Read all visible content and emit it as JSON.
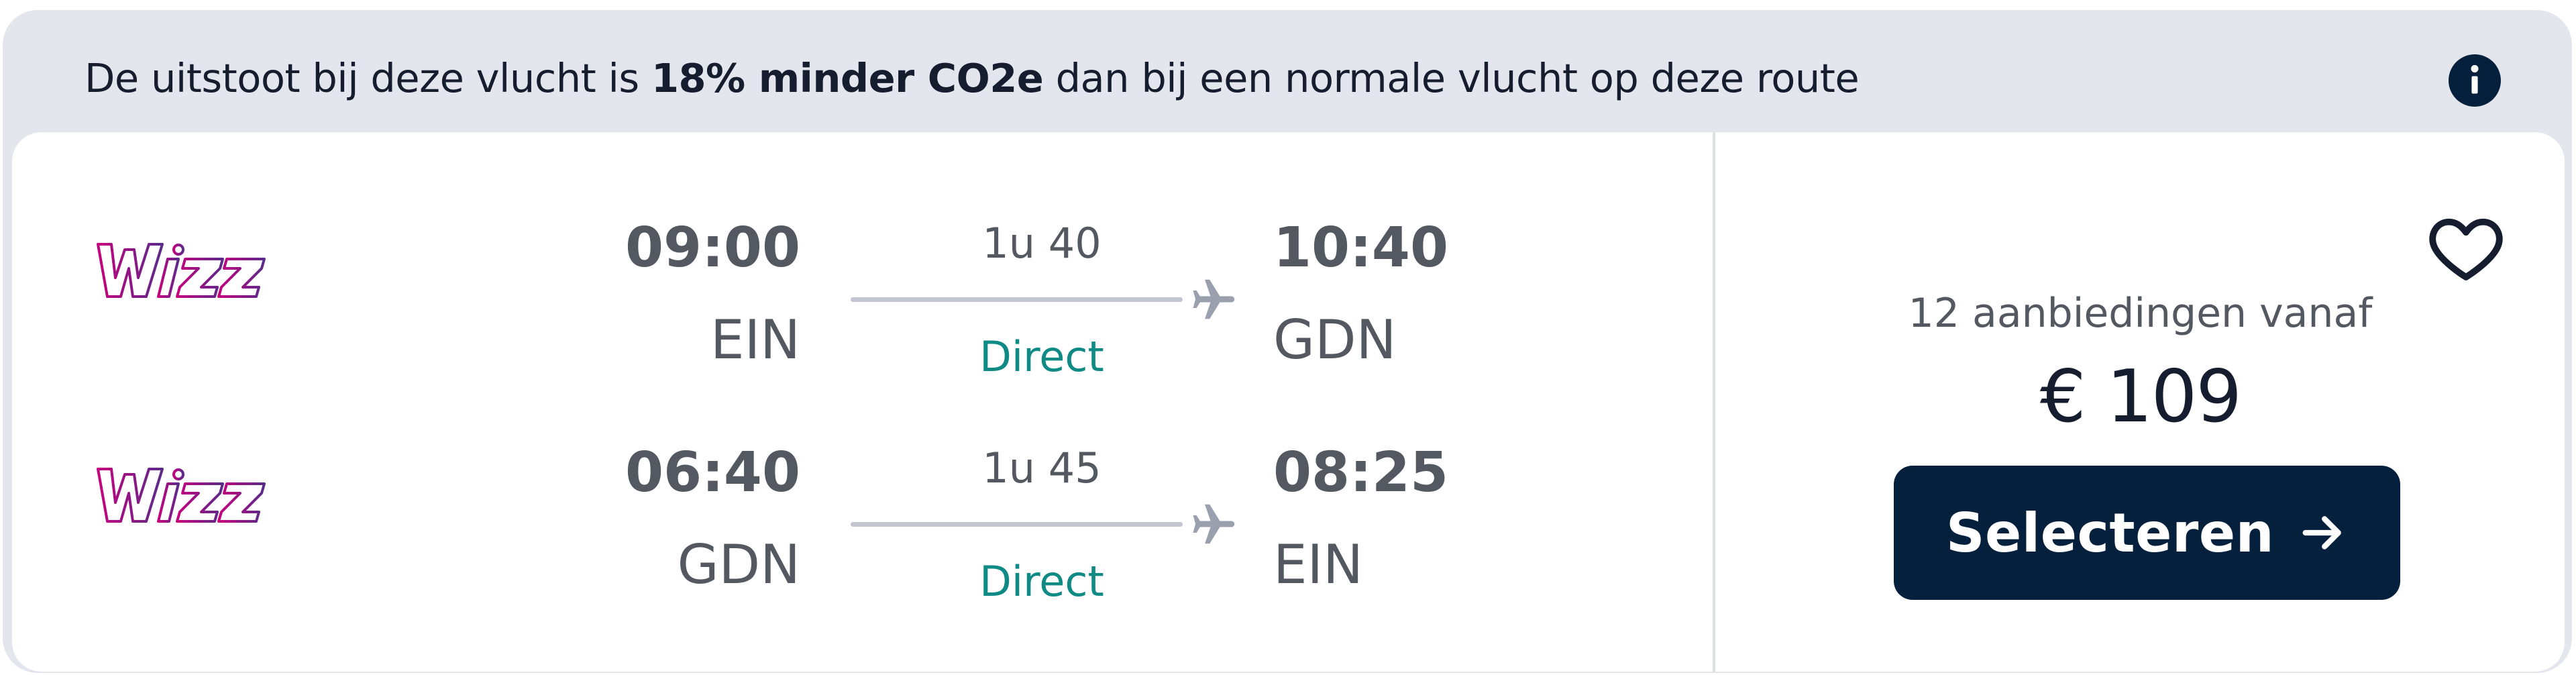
{
  "banner": {
    "text_before": "De uitstoot bij deze vlucht is ",
    "text_bold": "18% minder CO2e",
    "text_after": " dan bij een normale vlucht op deze route",
    "icon": "info-icon"
  },
  "legs": [
    {
      "airline": "Wizz",
      "departure_time": "09:00",
      "departure_airport": "EIN",
      "duration": "1u 40",
      "stops": "Direct",
      "arrival_time": "10:40",
      "arrival_airport": "GDN"
    },
    {
      "airline": "Wizz",
      "departure_time": "06:40",
      "departure_airport": "GDN",
      "duration": "1u 45",
      "stops": "Direct",
      "arrival_time": "08:25",
      "arrival_airport": "EIN"
    }
  ],
  "summary": {
    "offers_label": "12 aanbiedingen vanaf",
    "price": "€ 109",
    "select_label": "Selecteren",
    "favorite_icon": "heart-icon",
    "select_icon": "arrow-right-icon"
  },
  "colors": {
    "banner_bg": "#e3e6ec",
    "text_dark": "#161d2f",
    "text_muted": "#545860",
    "direct_green": "#0f8a84",
    "button_bg": "#05203c",
    "wizz_pink": "#c6007e",
    "wizz_purple": "#5b2b8a"
  }
}
